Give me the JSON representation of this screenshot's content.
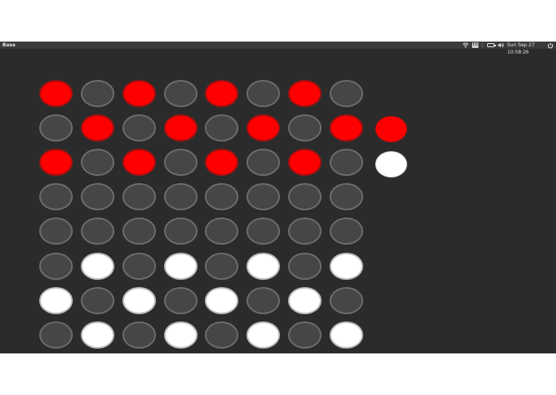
{
  "panel": {
    "app_title": "Base",
    "keyboard_label": "EN",
    "clock": "Sun Sep 27 10:58:26",
    "icons": [
      "wifi-icon",
      "keyboard-layout-icon",
      "battery-icon",
      "volume-icon",
      "power-icon"
    ]
  },
  "colors": {
    "background": "#2b2b2b",
    "empty_cell": "#464646",
    "red_piece": "#ff0000",
    "white_piece": "#ffffff"
  },
  "board": {
    "rows": 8,
    "cols": 8,
    "cells": [
      [
        "red",
        "empty",
        "red",
        "empty",
        "red",
        "empty",
        "red",
        "empty"
      ],
      [
        "empty",
        "red",
        "empty",
        "red",
        "empty",
        "red",
        "empty",
        "red"
      ],
      [
        "red",
        "empty",
        "red",
        "empty",
        "red",
        "empty",
        "red",
        "empty"
      ],
      [
        "empty",
        "empty",
        "empty",
        "empty",
        "empty",
        "empty",
        "empty",
        "empty"
      ],
      [
        "empty",
        "empty",
        "empty",
        "empty",
        "empty",
        "empty",
        "empty",
        "empty"
      ],
      [
        "empty",
        "white",
        "empty",
        "white",
        "empty",
        "white",
        "empty",
        "white"
      ],
      [
        "white",
        "empty",
        "white",
        "empty",
        "white",
        "empty",
        "white",
        "empty"
      ],
      [
        "empty",
        "white",
        "empty",
        "white",
        "empty",
        "white",
        "empty",
        "white"
      ]
    ]
  },
  "side_pieces": [
    "red",
    "white"
  ]
}
